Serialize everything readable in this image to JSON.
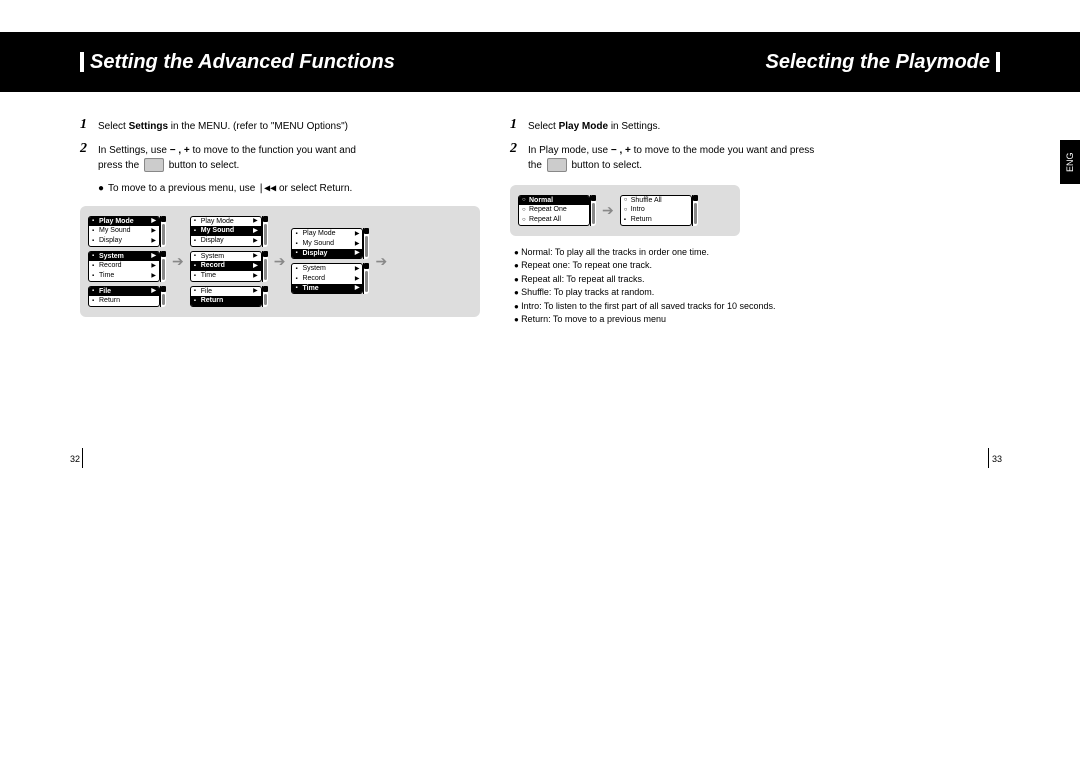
{
  "left": {
    "title": "Setting the Advanced Functions",
    "step1": {
      "pre": "Select ",
      "bold": "Settings",
      "post": " in the MENU. (refer to \"MENU Options\")"
    },
    "step2": {
      "line1_a": "In Settings, use ",
      "line1_b": " to move to the function you want and",
      "line2": "press the",
      "line2_b": " button to select.",
      "minus_plus": "− , +"
    },
    "note": {
      "pre": "To move to a previous menu, use ",
      "icon": "|◀◀",
      "post": " or select Return."
    },
    "menus": [
      {
        "items": [
          "Play Mode",
          "My Sound",
          "Display"
        ],
        "hl": 0
      },
      {
        "items": [
          "System",
          "Record",
          "Time"
        ],
        "hl": 0
      },
      {
        "items": [
          "File",
          "Return"
        ],
        "hl": 0
      },
      {
        "items": [
          "Play Mode",
          "My Sound",
          "Display"
        ],
        "hl": 1
      },
      {
        "items": [
          "System",
          "Record",
          "Time"
        ],
        "hl": 1
      },
      {
        "items": [
          "File",
          "Return"
        ],
        "hl": 1
      },
      {
        "items": [
          "Play Mode",
          "My Sound",
          "Display"
        ],
        "hl": 2
      },
      {
        "items": [
          "System",
          "Record",
          "Time"
        ],
        "hl": 2
      }
    ],
    "page_num": "32"
  },
  "right": {
    "title": "Selecting the Playmode",
    "step1": {
      "pre": "Select ",
      "bold": "Play Mode",
      "post": " in Settings."
    },
    "step2": {
      "line1_a": "In Play mode, use ",
      "line1_b": " to move to the mode you want and press",
      "line2": "the",
      "line2_b": " button to select.",
      "minus_plus": "− , +"
    },
    "menus": [
      {
        "items": [
          "Normal",
          "Repeat One",
          "Repeat All"
        ],
        "hl": 0
      },
      {
        "items": [
          "Shuffle All",
          "Intro",
          "Return"
        ],
        "hl": -1
      }
    ],
    "desc": [
      "Normal: To play all the tracks in order one time.",
      "Repeat one: To repeat one track.",
      "Repeat all: To repeat all tracks.",
      "Shuffle: To play tracks at random.",
      "Intro: To listen to the first part of all saved tracks for 10 seconds.",
      "Return: To move to a previous menu"
    ],
    "page_num": "33",
    "lang": "ENG"
  }
}
